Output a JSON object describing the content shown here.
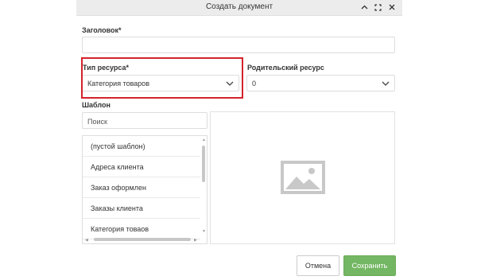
{
  "dialog": {
    "title": "Создать документ",
    "controls": [
      "chevron-up-icon",
      "maximize-icon",
      "close-icon"
    ]
  },
  "form": {
    "title_label": "Заголовок*",
    "title_value": "",
    "resource_type_label": "Тип ресурса*",
    "resource_type_value": "Категория товаров",
    "parent_label": "Родительский ресурс",
    "parent_value": "0",
    "template_label": "Шаблон",
    "search_placeholder": "Поиск",
    "templates": [
      "(пустой шаблон)",
      "Адреса клиента",
      "Заказ оформлен",
      "Заказы клиента",
      "Категория товаов"
    ]
  },
  "buttons": {
    "cancel": "Отмена",
    "save": "Сохранить"
  },
  "colors": {
    "highlight": "#d4232b",
    "save": "#73b663",
    "titlebar": "#ececec"
  }
}
